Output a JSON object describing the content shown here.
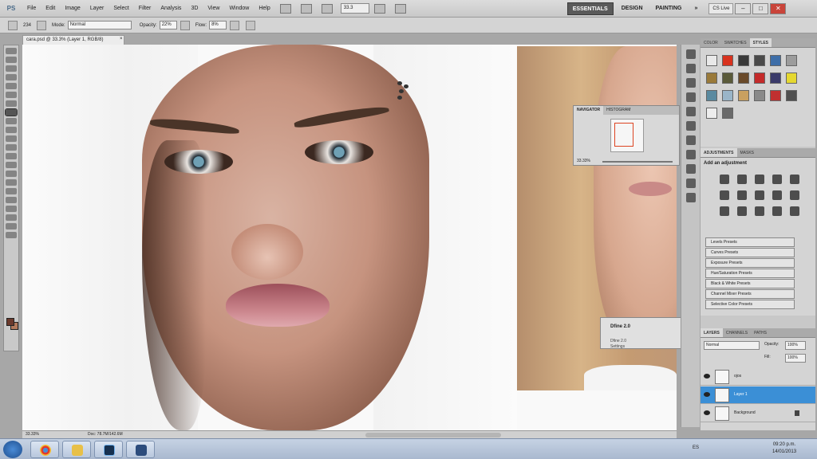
{
  "app": {
    "logo": "PS",
    "menu": [
      "File",
      "Edit",
      "Image",
      "Layer",
      "Select",
      "Filter",
      "Analysis",
      "3D",
      "View",
      "Window",
      "Help"
    ],
    "zoom_field": "33.3",
    "workspaces": [
      "ESSENTIALS",
      "DESIGN",
      "PAINTING"
    ],
    "more_workspaces": "»",
    "cs_live": "CS Live",
    "window_buttons": [
      "–",
      "□",
      "✕"
    ]
  },
  "options": {
    "brush_size": "234",
    "mode_label": "Mode:",
    "mode_value": "Normal",
    "opacity_label": "Opacity:",
    "opacity_value": "22%",
    "flow_label": "Flow:",
    "flow_value": "8%"
  },
  "document": {
    "tab_title": "cara.psd @ 33.3% (Layer 1, RGB/8)",
    "tab_close": "×",
    "status_zoom": "33.33%",
    "status_doc": "Doc: 78.7M/142.6M"
  },
  "navigator": {
    "tabs": [
      "NAVIGATOR",
      "HISTOGRAM"
    ],
    "zoom": "33.33%"
  },
  "dfine": {
    "title": "Dfine 2.0",
    "subtitle": "Dfine 2.0",
    "settings": "Settings"
  },
  "styles_panel": {
    "tabs": [
      "COLOR",
      "SWATCHES",
      "STYLES"
    ],
    "swatches": [
      "#e9e9e9",
      "#d8321e",
      "#3a3a3a",
      "#4a4a4a",
      "#3e6ea8",
      "#9c9c9c",
      "#9a7a3a",
      "#5a5a3a",
      "#6a4a2a",
      "#c42a2a",
      "#3a3a6a",
      "#e5d830",
      "#5a8aa0",
      "#9ab5c8",
      "#c9a060",
      "#8a8a8a",
      "#c03030",
      "#4f4f4f",
      "#ededed",
      "#6a6a6a"
    ]
  },
  "adjustments": {
    "tabs": [
      "ADJUSTMENTS",
      "MASKS"
    ],
    "title": "Add an adjustment",
    "presets": [
      "Levels Presets",
      "Curves Presets",
      "Exposure Presets",
      "Hue/Saturation Presets",
      "Black & White Presets",
      "Channel Mixer Presets",
      "Selective Color Presets"
    ]
  },
  "layers_panel": {
    "tabs": [
      "LAYERS",
      "CHANNELS",
      "PATHS"
    ],
    "blend_mode": "Normal",
    "opacity_label": "Opacity:",
    "opacity_value": "100%",
    "fill_label": "Fill:",
    "fill_value": "100%",
    "layers": [
      {
        "name": "ojos",
        "selected": false
      },
      {
        "name": "Layer 1",
        "selected": true
      },
      {
        "name": "Background",
        "selected": false
      }
    ]
  },
  "taskbar": {
    "tray": "ES",
    "time": "09:20 p.m.",
    "date": "14/01/2013"
  },
  "colors": {
    "foreground": "#6b3a2d",
    "background": "#b27a5c",
    "selection": "#3b8fd6"
  }
}
